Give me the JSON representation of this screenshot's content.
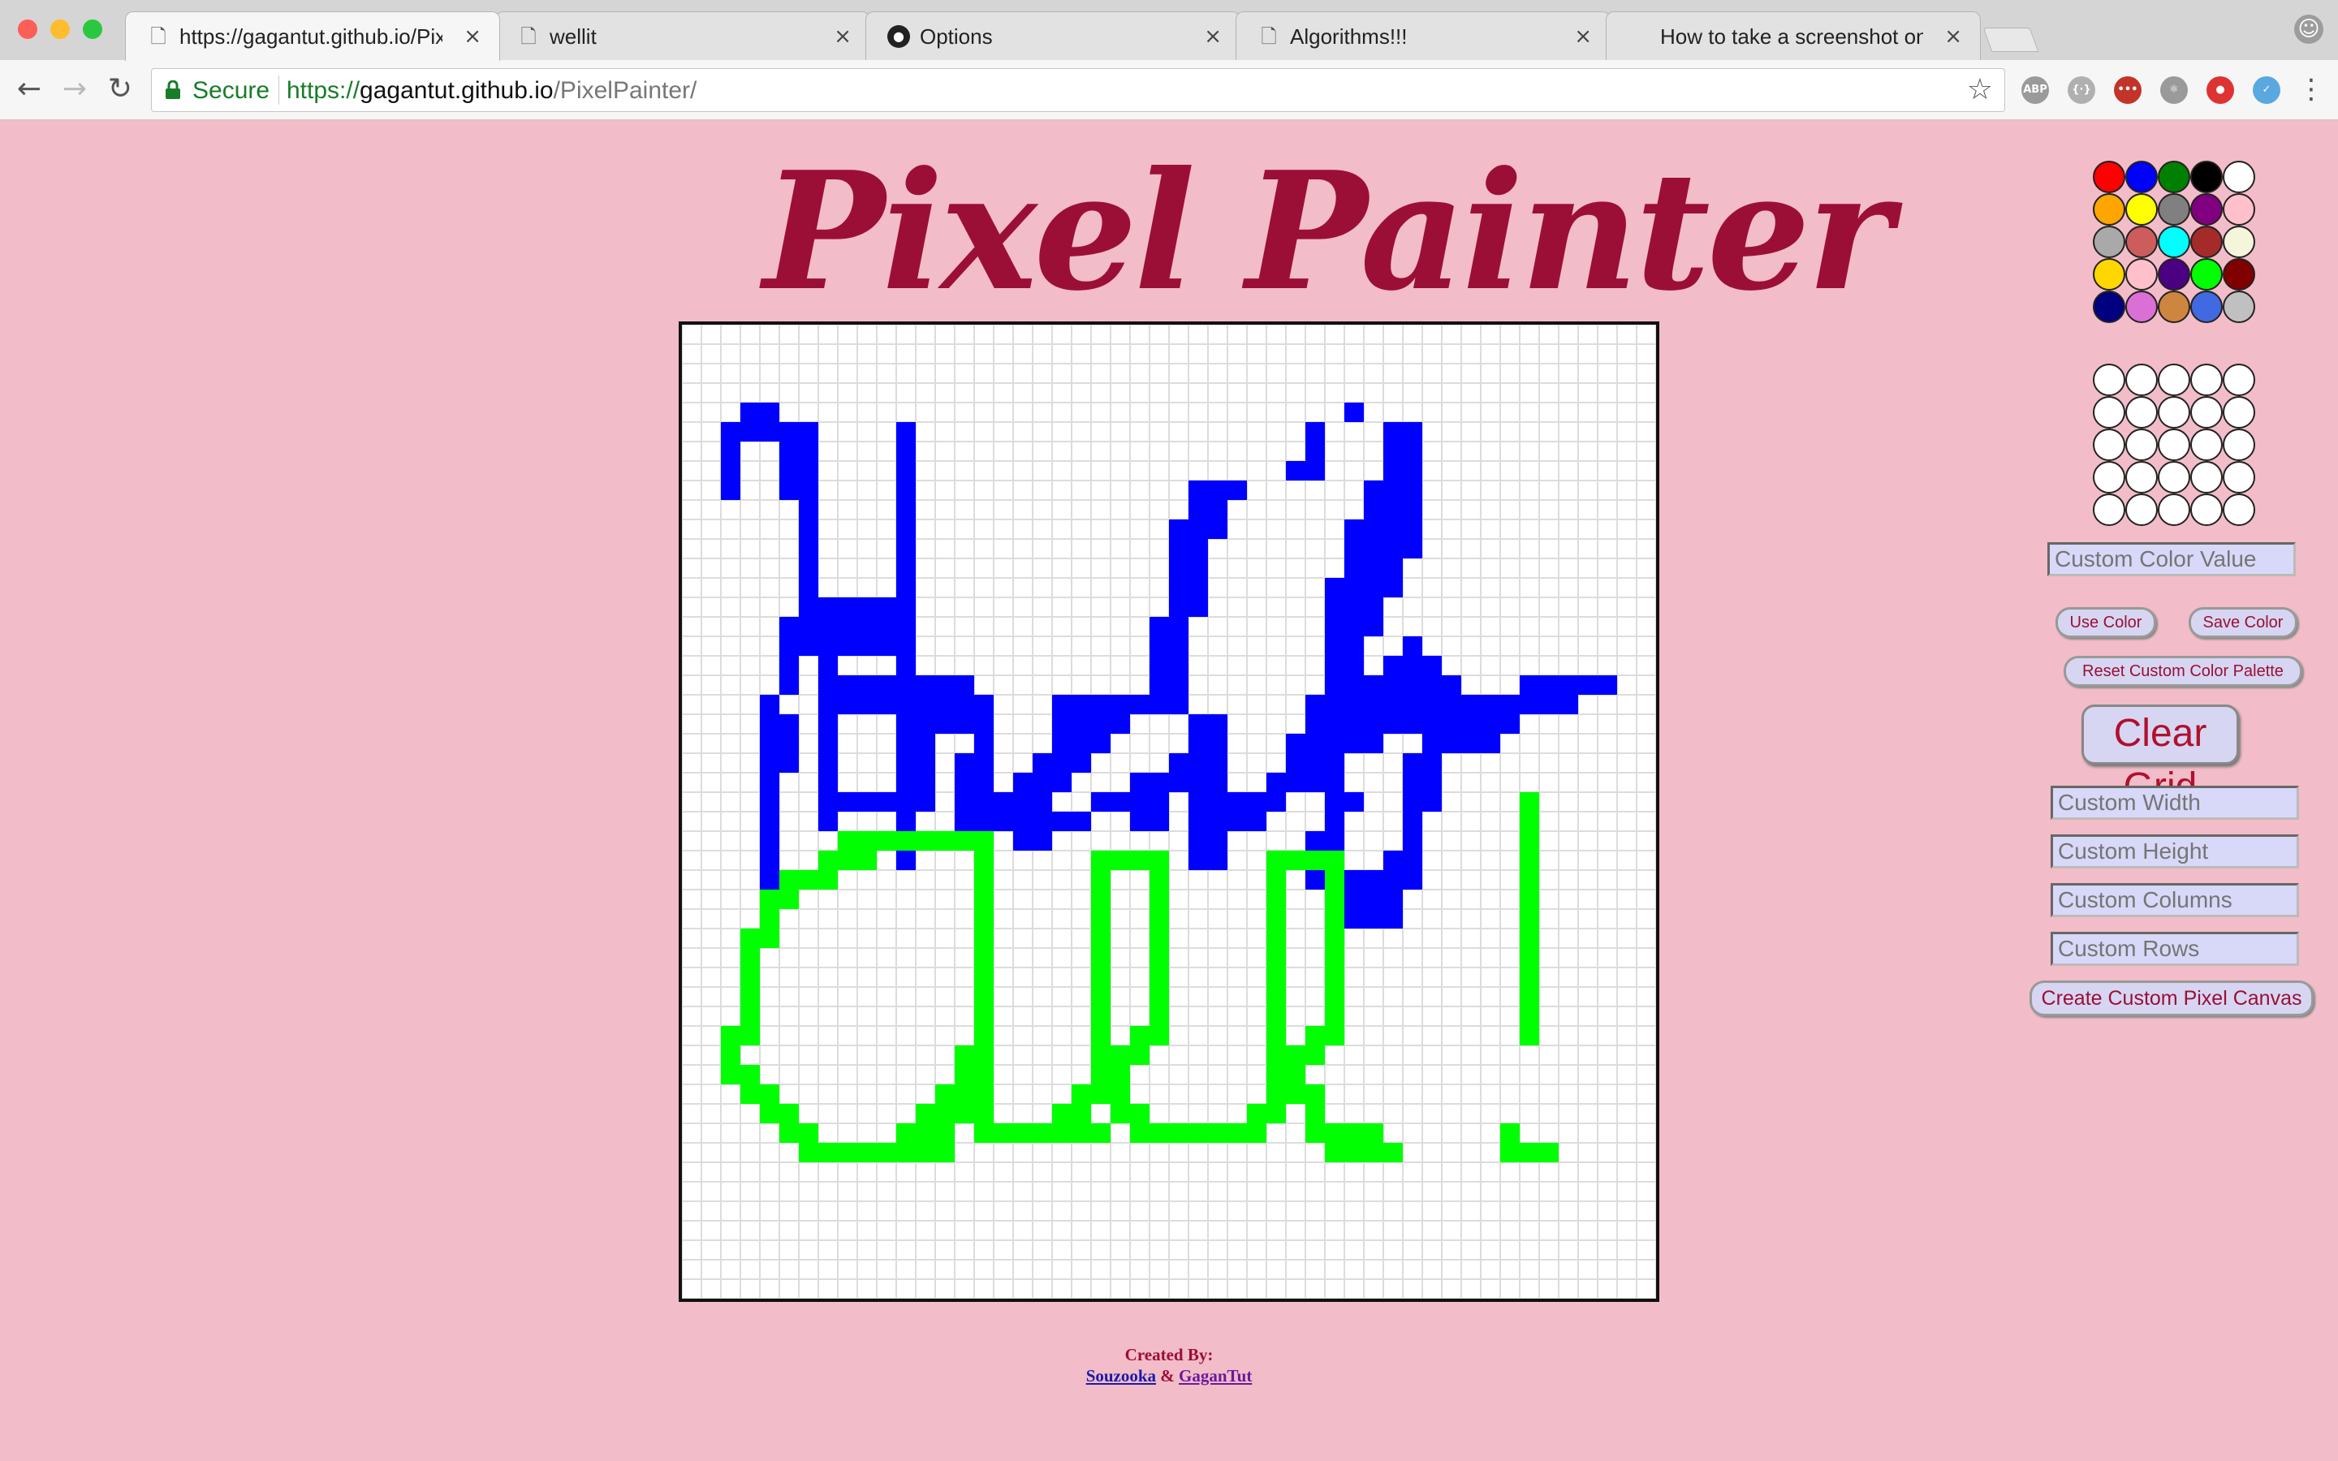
{
  "browser": {
    "tabs": [
      {
        "label": "https://gagantut.github.io/PixelPainter/",
        "icon": "page-icon",
        "active": true
      },
      {
        "label": "wellit",
        "icon": "page-icon",
        "active": false
      },
      {
        "label": "Options",
        "icon": "github-icon",
        "active": false
      },
      {
        "label": "Algorithms!!!",
        "icon": "page-icon",
        "active": false
      },
      {
        "label": "How to take a screenshot on your Mac",
        "icon": "apple-icon",
        "active": false
      }
    ],
    "secure_label": "Secure",
    "url_scheme": "https://",
    "url_host": "gagantut.github.io",
    "url_path": "/PixelPainter/",
    "close_glyph": "×",
    "extensions": [
      {
        "name": "adblock-icon",
        "text": "ABP",
        "color": "#9a9a9a"
      },
      {
        "name": "dots-extension-icon",
        "text": "{·}",
        "color": "#b0b0b0"
      },
      {
        "name": "lastpass-icon",
        "text": "•••",
        "color": "#c2342a"
      },
      {
        "name": "react-icon",
        "text": "⚛",
        "color": "#9a9a9a"
      },
      {
        "name": "record-icon",
        "text": "●",
        "color": "#d33"
      },
      {
        "name": "bird-extension-icon",
        "text": "✓",
        "color": "#5aa8e0"
      }
    ]
  },
  "app": {
    "title": "Pixel Painter",
    "grid": {
      "columns": 50,
      "rows": 50,
      "blue": "#0000ff",
      "green": "#00ff00",
      "hello": [
        "r4 c3-4 c34",
        "r5 c2-6 c11 c32 c36-37",
        "r6 c2 c5-6 c11 c32 c36-37",
        "r7 c2 c5-6 c11 c31-32 c36-37",
        "r8 c2 c5-6 c11 c26-28 c35-37",
        "r9 c6 c11 c26-27 c35-37",
        "r10 c6 c11 c25-27 c34-37",
        "r11 c6 c11 c25-26 c34-37",
        "r12 c6 c11 c25-26 c34-36",
        "r13 c6 c11 c25-26 c33-36",
        "r14 c6-11 c25-26 c33-35",
        "r15 c5-11 c24-25 c33-35",
        "r16 c5-11 c24-25 c33-34 c37",
        "r17 c5 c7 c11 c24-25 c33-34 c36-38",
        "r18 c5 c7-14 c24-25 c33-34 c35-39 c43-44 c45-47",
        "r19 c4 c7-15 c19-23 c24-25 c32-34 c35-42 c43-45",
        "r20 c4-5 c7 c11-15 c19-22 c26-27 c32-37 c38-42",
        "r21 c4-5 c7 c11-12 c15 c19-21 c26-27 c31-35 c38-41",
        "r22 c4-5 c7 c11-12 c14-15 c18-20 c25-27 c31-33 c37-38",
        "r23 c4 c7 c11-12 c14-15 c17-19 c23-27 c30-33 c37-38",
        "r24 c4 c7-12 c14-15 c16-18 c21-24 c26-30 c33-34 c37-38",
        "r25 c4 c7 c11 c14-16 c17-20 c23-24 c26-29 c33 c37",
        "r26 c4 c11 c15 c17-18 c26-27 c32-33 c37",
        "r27 c4 c11 c15 c26-27 c32-33 c36-37",
        "r28 c4 c32 c34-35 c36-37",
        "r29 c33-36",
        "r30 c34-36"
      ],
      "all": [
        "r24 c43",
        "r25 c43",
        "r26 c8-15 c43",
        "r27 c7-9 c15 c21-24 c30-33 c43",
        "r28 c5-7 c15 c21 c24 c30 c33 c43",
        "r29 c4-5 c15 c21 c24 c30 c33 c43",
        "r30 c4 c15 c21 c24 c30 c33 c43",
        "r31 c3-4 c15 c21 c24 c30 c33 c43",
        "r32 c3 c15 c21 c24 c30 c33 c43",
        "r33 c3 c15 c21 c24 c30 c33 c43",
        "r34 c3 c15 c21 c24 c30 c33 c43",
        "r35 c3 c15 c21 c24 c30 c33 c43",
        "r36 c2-3 c15 c21 c23-24 c30 c32-33 c43",
        "r37 c2 c14-15 c21-23 c30-32",
        "r38 c2-3 c14-15 c21-22 c30-31",
        "r39 c3-4 c13-15 c20-22 c30-32",
        "r40 c4-5 c12-15 c19-20 c22-23 c29-30 c32",
        "r41 c5-6 c11-13 c15-21 c23-29 c32-35 c42",
        "r42 c6-13 c33-36 c42-44"
      ]
    },
    "palette": {
      "colors": [
        "#ff0000",
        "#0000ff",
        "#008000",
        "#000000",
        "#ffffff",
        "#ffa500",
        "#ffff00",
        "#808080",
        "#800080",
        "#ffc0cb",
        "#a9a9a9",
        "#cd5c5c",
        "#00ffff",
        "#a52a2a",
        "#f5f5dc",
        "#ffd700",
        "#ffc0cb",
        "#4b0082",
        "#00ff00",
        "#800000",
        "#000080",
        "#da70d6",
        "#cd853f",
        "#4169e1",
        "#c0c0c0"
      ],
      "custom_slots": [
        "#ffffff",
        "#ffffff",
        "#ffffff",
        "#ffffff",
        "#ffffff",
        "#ffffff",
        "#ffffff",
        "#ffffff",
        "#ffffff",
        "#ffffff",
        "#ffffff",
        "#ffffff",
        "#ffffff",
        "#ffffff",
        "#ffffff",
        "#ffffff",
        "#ffffff",
        "#ffffff",
        "#ffffff",
        "#ffffff",
        "#ffffff",
        "#ffffff",
        "#ffffff",
        "#ffffff",
        "#ffffff"
      ]
    },
    "controls": {
      "custom_color_placeholder": "Custom Color Value",
      "use_color": "Use Color",
      "save_color": "Save Color",
      "reset_palette": "Reset Custom Color Palette",
      "clear_grid": "Clear Grid",
      "width_placeholder": "Custom Width",
      "height_placeholder": "Custom Height",
      "columns_placeholder": "Custom Columns",
      "rows_placeholder": "Custom Rows",
      "create_canvas": "Create Custom Pixel Canvas"
    },
    "credits": {
      "created_by": "Created By:",
      "author1": "Souzooka",
      "separator": "&",
      "author2": "GaganTut"
    }
  }
}
